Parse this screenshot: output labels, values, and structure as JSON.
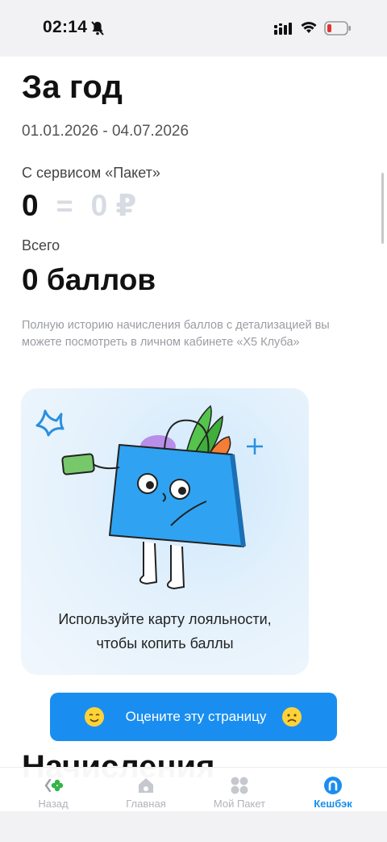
{
  "status_bar": {
    "time": "02:14"
  },
  "header": {
    "title": "За год",
    "date_range": "01.01.2026 - 04.07.2026"
  },
  "paket": {
    "label": "С сервисом «Пакет»",
    "points": "0",
    "equals": "=",
    "rubles": "0 ₽"
  },
  "total": {
    "label": "Всего",
    "value": "0 баллов"
  },
  "note": "Полную историю начисления баллов с детализацией вы можете посмотреть в личном кабинете «X5 Клуба»",
  "promo": {
    "line1": "Используйте карту лояльности,",
    "line2": "чтобы копить баллы"
  },
  "rate": {
    "label": "Оцените эту страницу"
  },
  "section": {
    "heading": "Начисления"
  },
  "nav": {
    "items": [
      {
        "label": "Назад",
        "icon": "back-logo-icon"
      },
      {
        "label": "Главная",
        "icon": "home-icon"
      },
      {
        "label": "Мой Пакет",
        "icon": "grid-icon"
      },
      {
        "label": "Кешбэк",
        "icon": "cashback-icon"
      }
    ],
    "active_index": 3
  },
  "colors": {
    "accent": "#1a8ef0",
    "muted": "#d7dbe2"
  }
}
